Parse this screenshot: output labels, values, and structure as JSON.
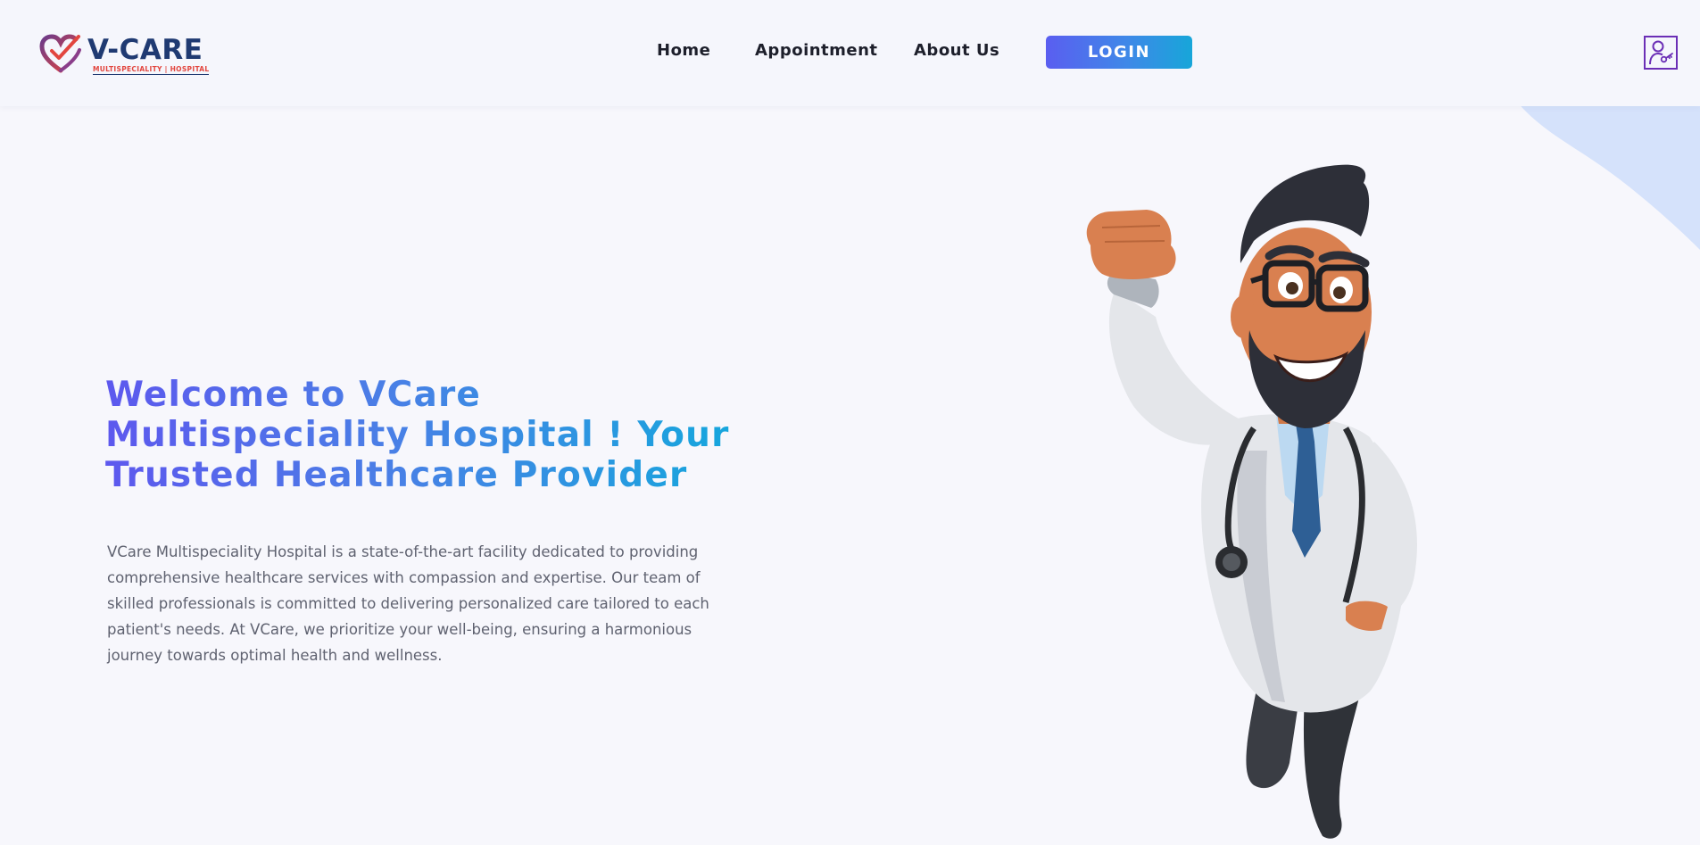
{
  "brand": {
    "name": "V-CARE",
    "tagline": "MULTISPECIALITY | HOSPITAL",
    "logo_icon": "heart-check-icon"
  },
  "nav": {
    "items": [
      {
        "label": "Home"
      },
      {
        "label": "Appointment"
      },
      {
        "label": "About Us"
      }
    ],
    "login_label": "LOGIN",
    "account_icon": "user-key-icon"
  },
  "hero": {
    "title": "Welcome to VCare Multispeciality Hospital ! Your Trusted Healthcare Provider",
    "description": "VCare Multispeciality Hospital is a state-of-the-art facility dedicated to providing comprehensive healthcare services with compassion and expertise. Our team of skilled professionals is committed to delivering personalized care tailored to each patient's needs. At VCare, we prioritize your well-being, ensuring a harmonious journey towards optimal health and wellness.",
    "illustration": "cartoon-doctor-flying"
  },
  "colors": {
    "accent_start": "#5a5ef0",
    "accent_end": "#17a6d9",
    "brand_navy": "#1f3a72",
    "brand_red": "#e2463f",
    "account_purple": "#6b2fb6",
    "background": "#f7f7fc"
  }
}
